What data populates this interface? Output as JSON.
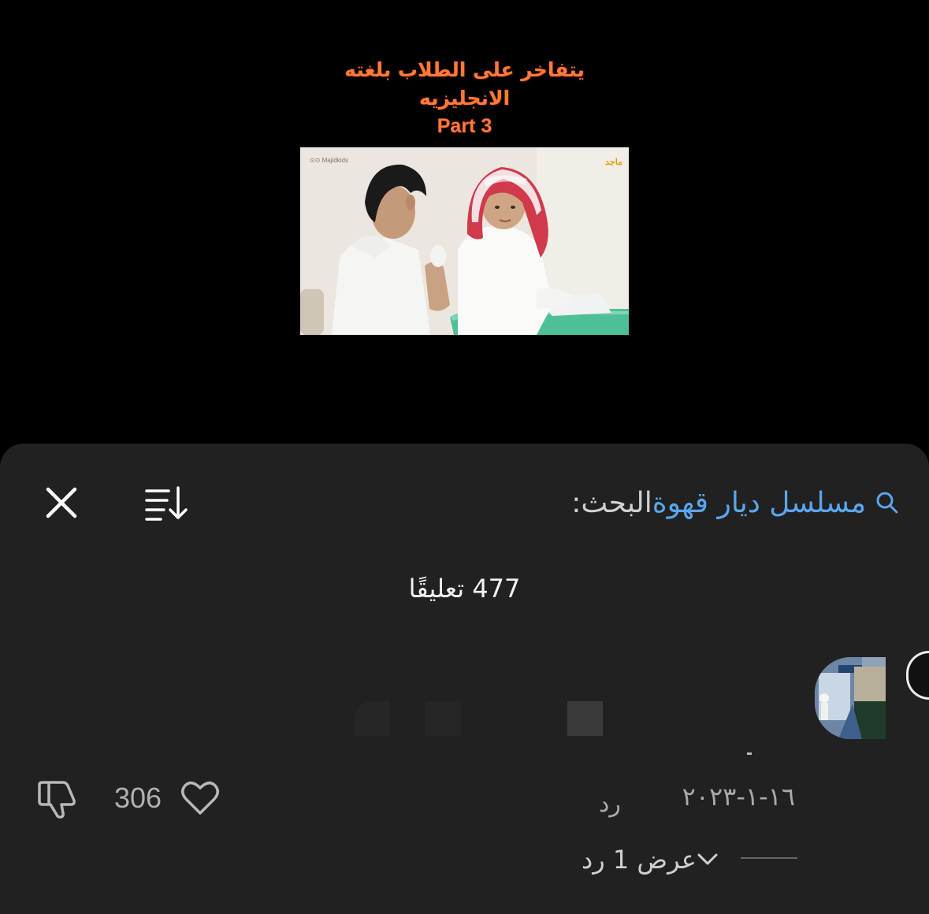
{
  "video": {
    "caption_line1": "يتفاخر على الطلاب بلغته",
    "caption_line2": "الانجليزيه",
    "caption_line3": "Part 3",
    "watermark_left": "⊙⊙ Majidkids",
    "watermark_right": "ماجد"
  },
  "comments": {
    "search_prefix": "البحث:",
    "search_query": "مسلسل ديار قهوة",
    "count_label": "477 تعليقًا",
    "items": [
      {
        "date": "١٦-١-٢٠٢٣",
        "reply_label": "رد",
        "likes": "306",
        "view_replies_label": "عرض 1 رد"
      }
    ]
  },
  "icons": {
    "close": "close-icon",
    "sort": "sort-icon",
    "search": "search-icon",
    "like": "heart-icon",
    "dislike": "thumbs-down-icon",
    "chevron": "chevron-down-icon"
  },
  "colors": {
    "sheet_bg": "#212121",
    "link_blue": "#5aa6ee",
    "caption_orange": "#ff7a3a"
  }
}
